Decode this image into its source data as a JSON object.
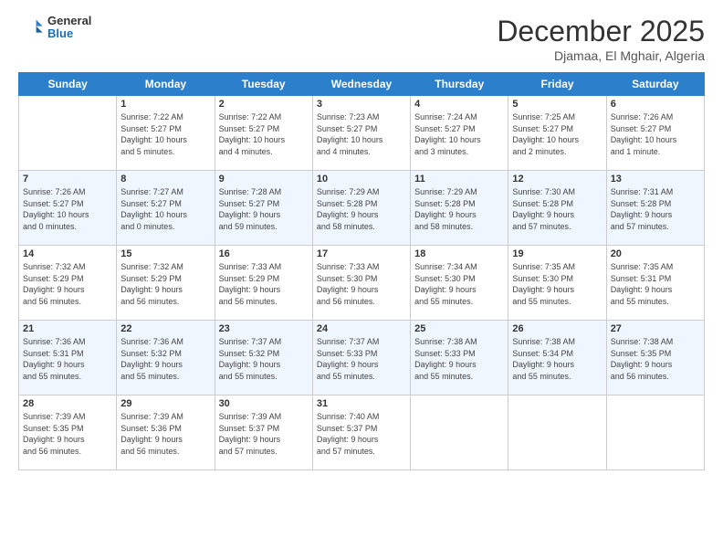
{
  "logo": {
    "general": "General",
    "blue": "Blue"
  },
  "header": {
    "month": "December 2025",
    "location": "Djamaa, El Mghair, Algeria"
  },
  "days_of_week": [
    "Sunday",
    "Monday",
    "Tuesday",
    "Wednesday",
    "Thursday",
    "Friday",
    "Saturday"
  ],
  "weeks": [
    [
      {
        "day": "",
        "info": ""
      },
      {
        "day": "1",
        "info": "Sunrise: 7:22 AM\nSunset: 5:27 PM\nDaylight: 10 hours\nand 5 minutes."
      },
      {
        "day": "2",
        "info": "Sunrise: 7:22 AM\nSunset: 5:27 PM\nDaylight: 10 hours\nand 4 minutes."
      },
      {
        "day": "3",
        "info": "Sunrise: 7:23 AM\nSunset: 5:27 PM\nDaylight: 10 hours\nand 4 minutes."
      },
      {
        "day": "4",
        "info": "Sunrise: 7:24 AM\nSunset: 5:27 PM\nDaylight: 10 hours\nand 3 minutes."
      },
      {
        "day": "5",
        "info": "Sunrise: 7:25 AM\nSunset: 5:27 PM\nDaylight: 10 hours\nand 2 minutes."
      },
      {
        "day": "6",
        "info": "Sunrise: 7:26 AM\nSunset: 5:27 PM\nDaylight: 10 hours\nand 1 minute."
      }
    ],
    [
      {
        "day": "7",
        "info": "Sunrise: 7:26 AM\nSunset: 5:27 PM\nDaylight: 10 hours\nand 0 minutes."
      },
      {
        "day": "8",
        "info": "Sunrise: 7:27 AM\nSunset: 5:27 PM\nDaylight: 10 hours\nand 0 minutes."
      },
      {
        "day": "9",
        "info": "Sunrise: 7:28 AM\nSunset: 5:27 PM\nDaylight: 9 hours\nand 59 minutes."
      },
      {
        "day": "10",
        "info": "Sunrise: 7:29 AM\nSunset: 5:28 PM\nDaylight: 9 hours\nand 58 minutes."
      },
      {
        "day": "11",
        "info": "Sunrise: 7:29 AM\nSunset: 5:28 PM\nDaylight: 9 hours\nand 58 minutes."
      },
      {
        "day": "12",
        "info": "Sunrise: 7:30 AM\nSunset: 5:28 PM\nDaylight: 9 hours\nand 57 minutes."
      },
      {
        "day": "13",
        "info": "Sunrise: 7:31 AM\nSunset: 5:28 PM\nDaylight: 9 hours\nand 57 minutes."
      }
    ],
    [
      {
        "day": "14",
        "info": "Sunrise: 7:32 AM\nSunset: 5:29 PM\nDaylight: 9 hours\nand 56 minutes."
      },
      {
        "day": "15",
        "info": "Sunrise: 7:32 AM\nSunset: 5:29 PM\nDaylight: 9 hours\nand 56 minutes."
      },
      {
        "day": "16",
        "info": "Sunrise: 7:33 AM\nSunset: 5:29 PM\nDaylight: 9 hours\nand 56 minutes."
      },
      {
        "day": "17",
        "info": "Sunrise: 7:33 AM\nSunset: 5:30 PM\nDaylight: 9 hours\nand 56 minutes."
      },
      {
        "day": "18",
        "info": "Sunrise: 7:34 AM\nSunset: 5:30 PM\nDaylight: 9 hours\nand 55 minutes."
      },
      {
        "day": "19",
        "info": "Sunrise: 7:35 AM\nSunset: 5:30 PM\nDaylight: 9 hours\nand 55 minutes."
      },
      {
        "day": "20",
        "info": "Sunrise: 7:35 AM\nSunset: 5:31 PM\nDaylight: 9 hours\nand 55 minutes."
      }
    ],
    [
      {
        "day": "21",
        "info": "Sunrise: 7:36 AM\nSunset: 5:31 PM\nDaylight: 9 hours\nand 55 minutes."
      },
      {
        "day": "22",
        "info": "Sunrise: 7:36 AM\nSunset: 5:32 PM\nDaylight: 9 hours\nand 55 minutes."
      },
      {
        "day": "23",
        "info": "Sunrise: 7:37 AM\nSunset: 5:32 PM\nDaylight: 9 hours\nand 55 minutes."
      },
      {
        "day": "24",
        "info": "Sunrise: 7:37 AM\nSunset: 5:33 PM\nDaylight: 9 hours\nand 55 minutes."
      },
      {
        "day": "25",
        "info": "Sunrise: 7:38 AM\nSunset: 5:33 PM\nDaylight: 9 hours\nand 55 minutes."
      },
      {
        "day": "26",
        "info": "Sunrise: 7:38 AM\nSunset: 5:34 PM\nDaylight: 9 hours\nand 55 minutes."
      },
      {
        "day": "27",
        "info": "Sunrise: 7:38 AM\nSunset: 5:35 PM\nDaylight: 9 hours\nand 56 minutes."
      }
    ],
    [
      {
        "day": "28",
        "info": "Sunrise: 7:39 AM\nSunset: 5:35 PM\nDaylight: 9 hours\nand 56 minutes."
      },
      {
        "day": "29",
        "info": "Sunrise: 7:39 AM\nSunset: 5:36 PM\nDaylight: 9 hours\nand 56 minutes."
      },
      {
        "day": "30",
        "info": "Sunrise: 7:39 AM\nSunset: 5:37 PM\nDaylight: 9 hours\nand 57 minutes."
      },
      {
        "day": "31",
        "info": "Sunrise: 7:40 AM\nSunset: 5:37 PM\nDaylight: 9 hours\nand 57 minutes."
      },
      {
        "day": "",
        "info": ""
      },
      {
        "day": "",
        "info": ""
      },
      {
        "day": "",
        "info": ""
      }
    ]
  ]
}
